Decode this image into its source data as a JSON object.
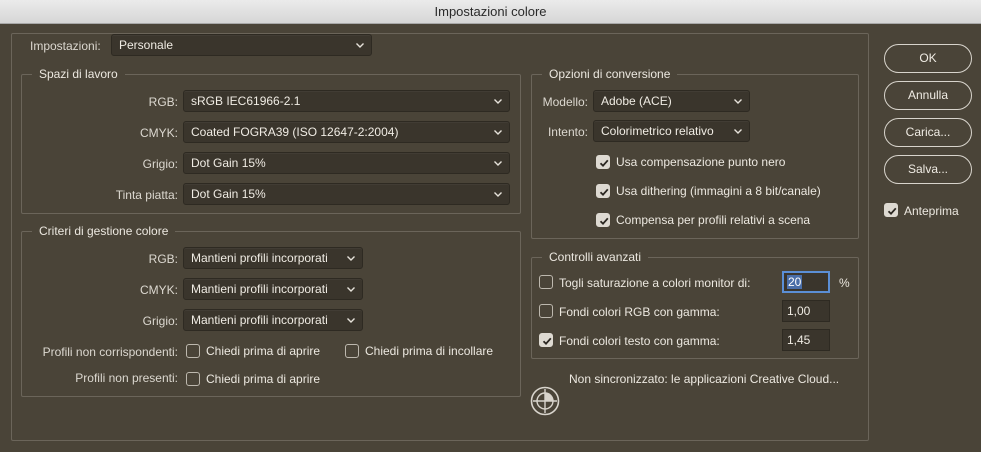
{
  "window": {
    "title": "Impostazioni colore"
  },
  "top": {
    "settings_label": "Impostazioni:",
    "settings_value": "Personale"
  },
  "workspaces": {
    "title": "Spazi di lavoro",
    "rgb_label": "RGB:",
    "rgb_value": "sRGB IEC61966-2.1",
    "cmyk_label": "CMYK:",
    "cmyk_value": "Coated FOGRA39 (ISO 12647-2:2004)",
    "gray_label": "Grigio:",
    "gray_value": "Dot Gain 15%",
    "spot_label": "Tinta piatta:",
    "spot_value": "Dot Gain 15%"
  },
  "policies": {
    "title": "Criteri di gestione colore",
    "rgb_label": "RGB:",
    "rgb_value": "Mantieni profili incorporati",
    "cmyk_label": "CMYK:",
    "cmyk_value": "Mantieni profili incorporati",
    "gray_label": "Grigio:",
    "gray_value": "Mantieni profili incorporati",
    "mismatch_label": "Profili non corrispondenti:",
    "mismatch_open": {
      "label": "Chiedi prima di aprire",
      "checked": false
    },
    "mismatch_paste": {
      "label": "Chiedi prima di incollare",
      "checked": false
    },
    "missing_label": "Profili non presenti:",
    "missing_open": {
      "label": "Chiedi prima di aprire",
      "checked": false
    }
  },
  "conversion": {
    "title": "Opzioni di conversione",
    "engine_label": "Modello:",
    "engine_value": "Adobe (ACE)",
    "intent_label": "Intento:",
    "intent_value": "Colorimetrico relativo",
    "black_point": {
      "label": "Usa compensazione punto nero",
      "checked": true
    },
    "dither": {
      "label": "Usa dithering (immagini a 8 bit/canale)",
      "checked": true
    },
    "scene": {
      "label": "Compensa per profili relativi a scena",
      "checked": true
    }
  },
  "advanced": {
    "title": "Controlli avanzati",
    "desaturate": {
      "label": "Togli saturazione a colori monitor di:",
      "checked": false,
      "value": "20",
      "unit": "%"
    },
    "blend_rgb": {
      "label": "Fondi colori RGB con gamma:",
      "checked": false,
      "value": "1,00"
    },
    "blend_text": {
      "label": "Fondi colori testo con gamma:",
      "checked": true,
      "value": "1,45"
    }
  },
  "sync": {
    "message": "Non sincronizzato: le applicazioni Creative Cloud..."
  },
  "buttons": {
    "ok": "OK",
    "cancel": "Annulla",
    "load": "Carica...",
    "save": "Salva...",
    "preview": {
      "label": "Anteprima",
      "checked": true
    }
  },
  "colors": {
    "background": "#4a4438",
    "field": "#3a352c",
    "focus": "#5b8fd6"
  }
}
